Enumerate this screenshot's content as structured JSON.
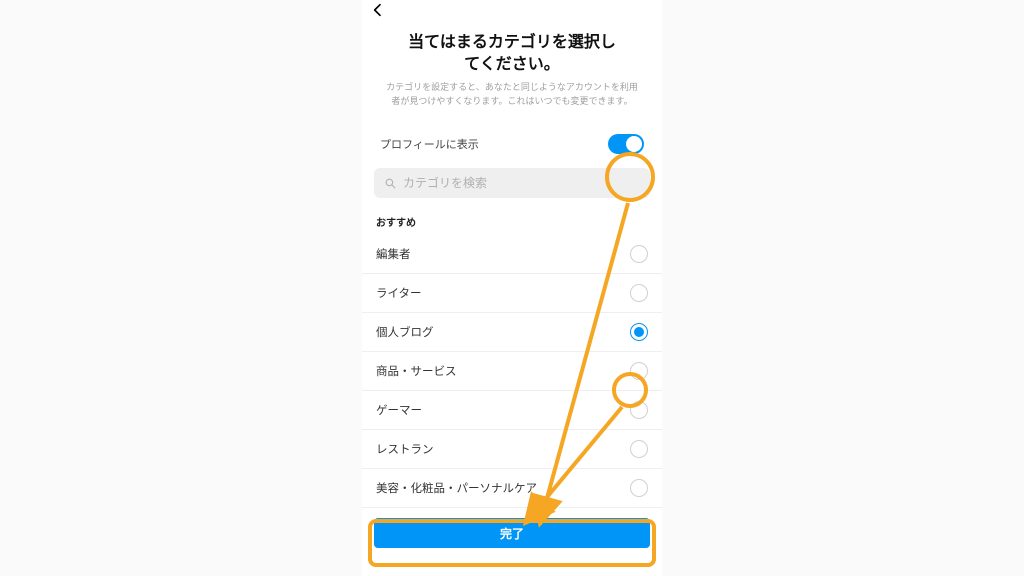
{
  "header": {
    "title_lines": [
      "当てはまるカテゴリを選択し",
      "てください。"
    ],
    "description": "カテゴリを設定すると、あなたと同じようなアカウントを利用者が見つけやすくなります。これはいつでも変更できます。"
  },
  "show_on_profile": {
    "label": "プロフィールに表示",
    "enabled": true
  },
  "search": {
    "placeholder": "カテゴリを検索"
  },
  "section_label": "おすすめ",
  "categories": [
    {
      "label": "編集者",
      "selected": false
    },
    {
      "label": "ライター",
      "selected": false
    },
    {
      "label": "個人ブログ",
      "selected": true
    },
    {
      "label": "商品・サービス",
      "selected": false
    },
    {
      "label": "ゲーマー",
      "selected": false
    },
    {
      "label": "レストラン",
      "selected": false
    },
    {
      "label": "美容・化粧品・パーソナルケア",
      "selected": false
    }
  ],
  "footer": {
    "done_label": "完了"
  },
  "colors": {
    "accent": "#0095f6",
    "annotation": "#f5a623"
  }
}
